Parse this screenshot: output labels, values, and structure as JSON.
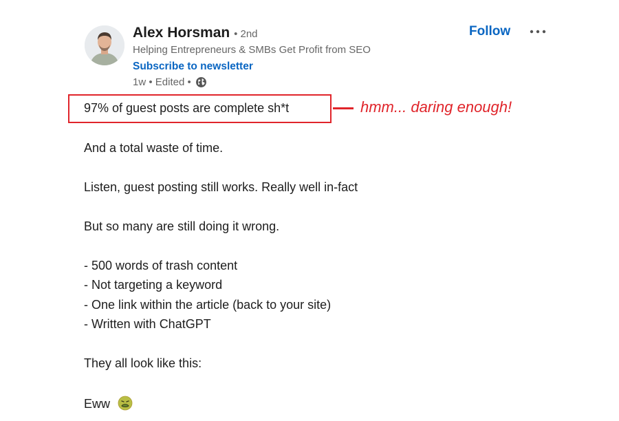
{
  "author": {
    "name": "Alex Horsman",
    "degree": "• 2nd",
    "headline": "Helping Entrepreneurs & SMBs Get Profit from SEO",
    "subscribe_label": "Subscribe to newsletter",
    "meta": "1w • Edited •",
    "avatar_icon": "profile-photo"
  },
  "actions": {
    "follow_label": "Follow",
    "more_icon": "more-horizontal-icon"
  },
  "post": {
    "hook": "97% of guest posts are complete sh*t",
    "annotation": "hmm... daring enough!",
    "line_1": "And a total waste of time.",
    "line_2": "Listen, guest posting still works. Really well in-fact",
    "line_3": "But so many are still doing it wrong.",
    "bullets": [
      "- 500 words of trash content",
      "- Not targeting a keyword",
      "- One link within the article (back to your site)",
      "- Written with ChatGPT"
    ],
    "line_4": "They all look like this:",
    "line_5": "Eww"
  },
  "colors": {
    "accent_blue": "#0a66c2",
    "annotation_red": "#e0242a"
  }
}
